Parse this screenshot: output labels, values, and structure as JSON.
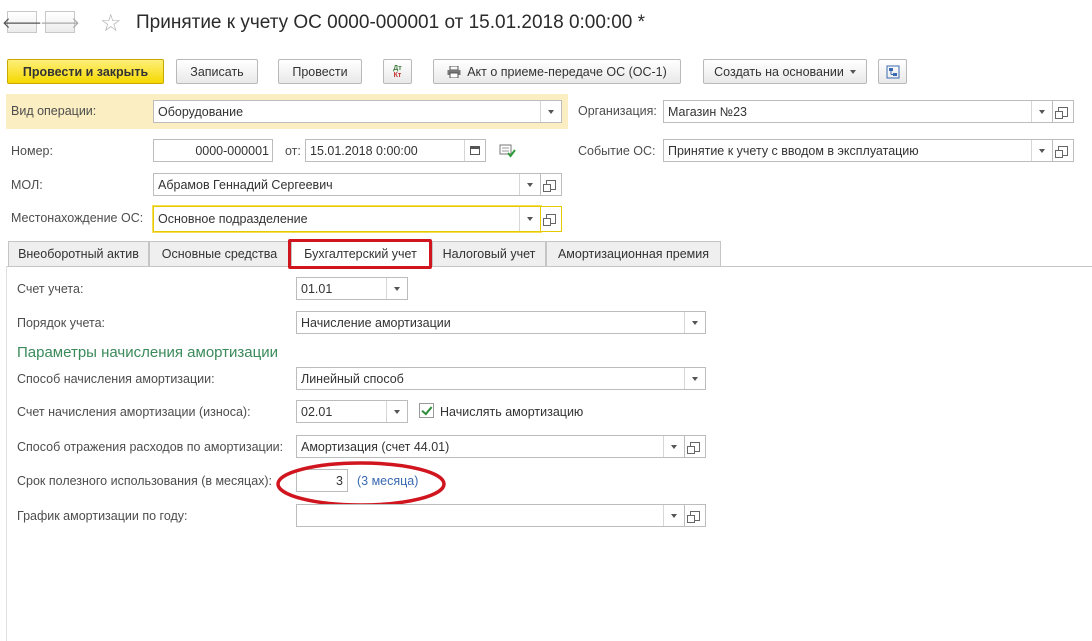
{
  "window": {
    "title": "Принятие к учету ОС 0000-000001 от 15.01.2018 0:00:00 *",
    "back_icon": "arrow-left-icon",
    "forward_icon": "arrow-right-icon",
    "favorite_icon": "star-icon",
    "back_glyph": "🡐",
    "forward_glyph": "🡒",
    "star_glyph": "☆"
  },
  "toolbar": {
    "post_close": "Провести и закрыть",
    "save": "Записать",
    "post": "Провести",
    "dtkt_top": "Дт",
    "dtkt_bottom": "Кт",
    "print_act": "Акт о приеме-передаче ОС (ОС-1)",
    "create_based": "Создать на основании"
  },
  "header": {
    "operation_label": "Вид операции:",
    "operation_value": "Оборудование",
    "org_label": "Организация:",
    "org_value": "Магазин №23",
    "number_label": "Номер:",
    "number_value": "0000-000001",
    "date_from_label": "от:",
    "date_value": "15.01.2018  0:00:00",
    "event_label": "Событие ОС:",
    "event_value": "Принятие к учету с вводом в эксплуатацию",
    "mol_label": "МОЛ:",
    "mol_value": "Абрамов Геннадий Сергеевич",
    "location_label": "Местонахождение ОС:",
    "location_value": "Основное подразделение"
  },
  "tabs": [
    {
      "label": "Внеоборотный актив"
    },
    {
      "label": "Основные средства"
    },
    {
      "label": "Бухгалтерский учет"
    },
    {
      "label": "Налоговый учет"
    },
    {
      "label": "Амортизационная премия"
    }
  ],
  "accounting": {
    "account_label": "Счет учета:",
    "account_value": "01.01",
    "order_label": "Порядок учета:",
    "order_value": "Начисление амортизации",
    "section_title": "Параметры начисления амортизации",
    "method_label": "Способ начисления амортизации:",
    "method_value": "Линейный способ",
    "depr_account_label": "Счет начисления амортизации (износа):",
    "depr_account_value": "02.01",
    "accrue_checkbox_label": "Начислять амортизацию",
    "accrue_checked": true,
    "expense_label": "Способ отражения расходов по амортизации:",
    "expense_value": "Амортизация (счет 44.01)",
    "useful_life_label": "Срок полезного использования (в месяцах):",
    "useful_life_value": "3",
    "useful_life_hint": "(3 месяца)",
    "schedule_label": "График амортизации по году:",
    "schedule_value": ""
  },
  "colors": {
    "primary_button": "#f5d800",
    "highlight_red": "#d0151f",
    "section_green": "#3a8a5a",
    "link_blue": "#3a6ab0"
  }
}
